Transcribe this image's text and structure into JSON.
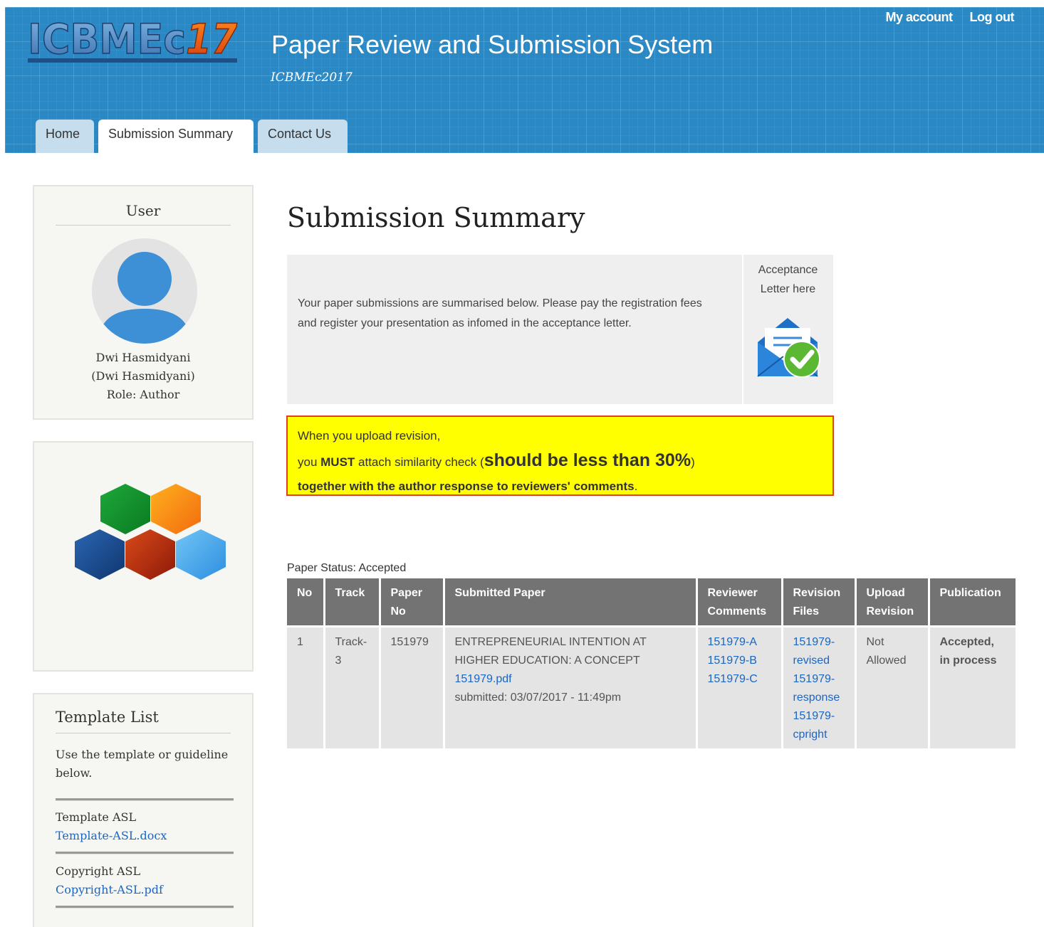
{
  "header": {
    "logo_text": "ICBMEc17",
    "site_name": "Paper Review and Submission System",
    "slogan": "ICBMEc2017",
    "user_menu": {
      "my_account": "My account",
      "logout": "Log out"
    },
    "tabs": [
      {
        "label": "Home",
        "active": false
      },
      {
        "label": "Submission Summary",
        "active": true
      },
      {
        "label": "Contact Us",
        "active": false
      }
    ]
  },
  "sidebar": {
    "user": {
      "title": "User",
      "name": "Dwi Hasmidyani",
      "username": "(Dwi Hasmidyani)",
      "role": "Role: Author"
    },
    "template_list": {
      "title": "Template List",
      "description": "Use the template or guideline below.",
      "items": [
        {
          "label": "Template ASL",
          "file": "Template-ASL.docx"
        },
        {
          "label": "Copyright ASL",
          "file": "Copyright-ASL.pdf"
        }
      ]
    }
  },
  "main": {
    "title": "Submission Summary",
    "info_text": "Your paper submissions are summarised below. Please pay the registration fees and register your presentation as infomed in the acceptance letter.",
    "acceptance_label": "Acceptance Letter here",
    "warning": {
      "line1": "When you upload revision,",
      "line2_pre": "you ",
      "line2_must": "MUST",
      "line2_mid": " attach similarity check (",
      "line2_big": "should be less than 30%",
      "line2_post": ")",
      "line3": "together with the author response to reviewers' comments",
      "line3_end": "."
    },
    "paper_status": "Paper Status: Accepted",
    "table": {
      "headers": {
        "no": "No",
        "track": "Track",
        "paper_no": "Paper No",
        "submitted_paper": "Submitted Paper",
        "reviewer_comments": "Reviewer Comments",
        "revision_files": "Revision Files",
        "upload_revision": "Upload Revision",
        "publication": "Publication"
      },
      "rows": [
        {
          "no": "1",
          "track": "Track-3",
          "paper_no": "151979",
          "title": "ENTREPRENEURIAL INTENTION AT HIGHER EDUCATION: A CONCEPT",
          "file": "151979.pdf",
          "submitted": "submitted: 03/07/2017 - 11:49pm",
          "reviewer_comments": [
            "151979-A",
            "151979-B",
            "151979-C"
          ],
          "revision_files": [
            "151979-revised",
            "151979-response",
            "151979-cpright"
          ],
          "upload_revision": "Not Allowed",
          "publication": "Accepted, in process"
        }
      ]
    }
  }
}
